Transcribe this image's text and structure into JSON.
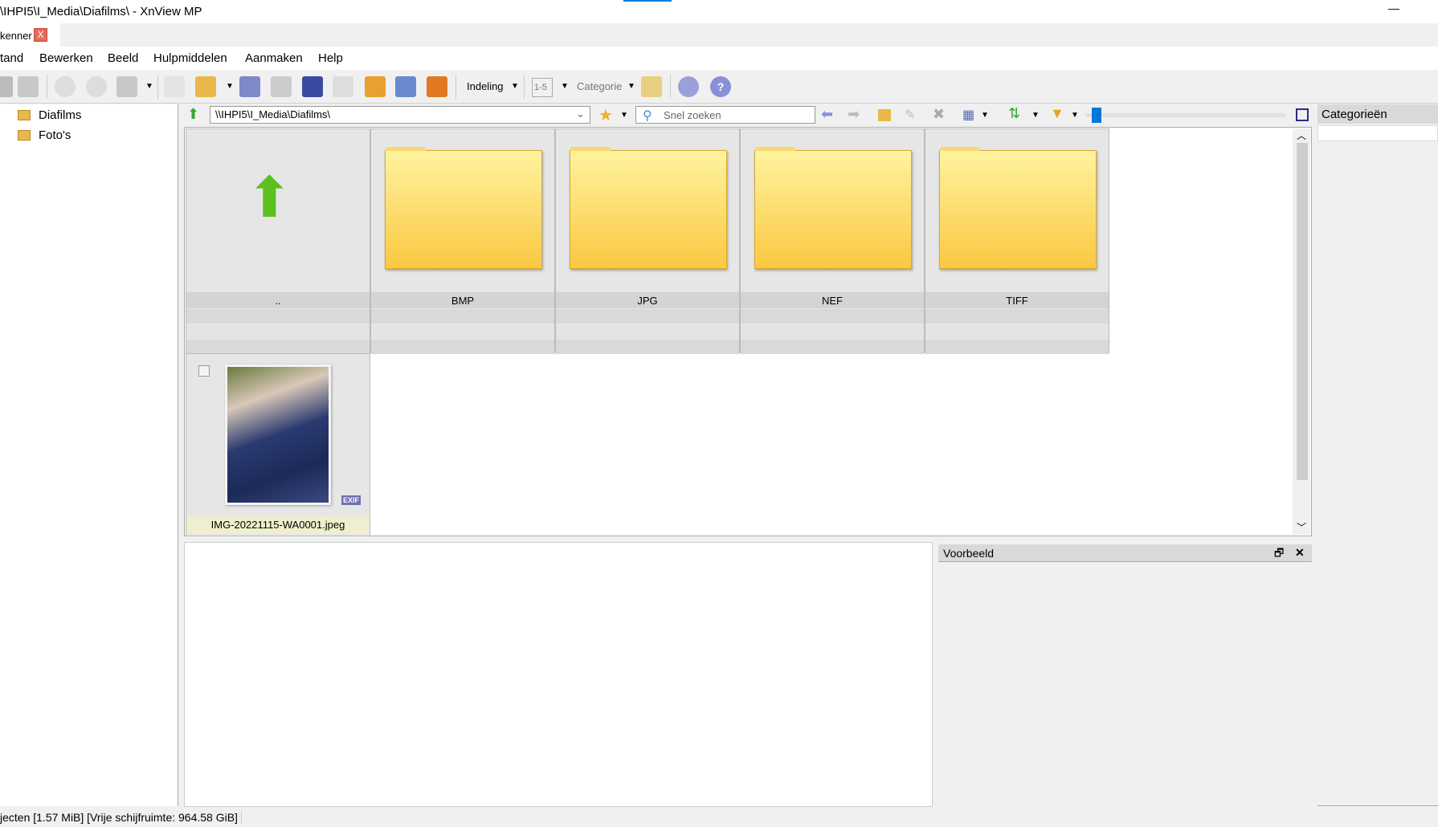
{
  "window": {
    "title": "\\IHPI5\\I_Media\\Diafilms\\ - XnView MP",
    "minimize": "—"
  },
  "tab": {
    "label": "kenner",
    "close": "X"
  },
  "menu": [
    "tand",
    "Bewerken",
    "Beeld",
    "Hulpmiddelen",
    "Aanmaken",
    "Help"
  ],
  "toolbar": {
    "layout_label": "Indeling",
    "category_label": "Categorie",
    "rating_label": "1-5"
  },
  "tree": [
    "Diafilms",
    "Foto's"
  ],
  "pathbar": {
    "path": "\\\\IHPI5\\I_Media\\Diafilms\\",
    "search_placeholder": "Snel zoeken"
  },
  "grid": {
    "items": [
      {
        "label": "..",
        "type": "parent"
      },
      {
        "label": "BMP",
        "type": "folder"
      },
      {
        "label": "JPG",
        "type": "folder"
      },
      {
        "label": "NEF",
        "type": "folder"
      },
      {
        "label": "TIFF",
        "type": "folder"
      }
    ],
    "image": {
      "label": "IMG-20221115-WA0001.jpeg",
      "badge": "EXIF"
    }
  },
  "thumb_slider_value": 0.03,
  "preview": {
    "title": "Voorbeeld",
    "restore": "🗗",
    "close": "✕"
  },
  "categories": {
    "title": "Categorieën"
  },
  "status": "jecten [1.57 MiB] [Vrije schijfruimte: 964.58 GiB]",
  "colors": {
    "folder": "#fbc840",
    "accent": "#0078d7"
  }
}
